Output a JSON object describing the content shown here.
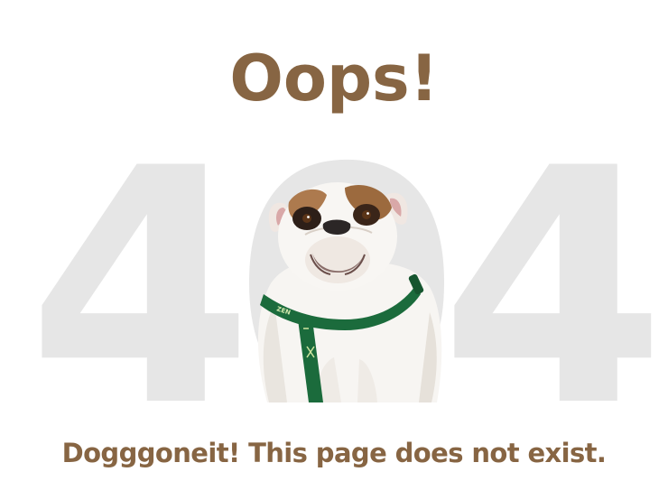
{
  "heading": "Oops!",
  "background_code": "404",
  "message": "Dogggoneit! This page does not exist.",
  "illustration": {
    "icon": "bulldog-icon",
    "collar_text": "ZEN"
  },
  "colors": {
    "heading": "#876543",
    "background_code": "#e6e6e6",
    "message": "#876543",
    "harness": "#1b6b3c"
  }
}
